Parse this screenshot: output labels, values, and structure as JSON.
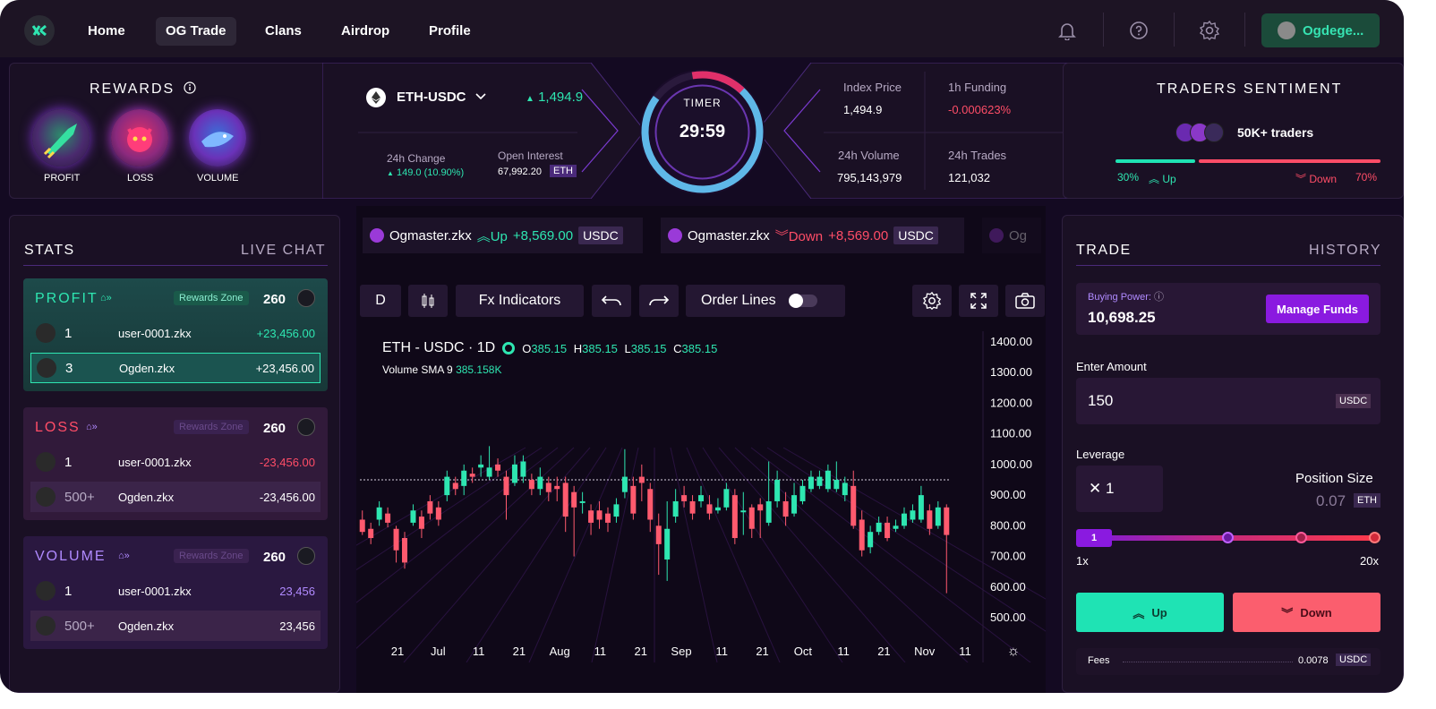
{
  "nav": {
    "items": [
      "Home",
      "OG Trade",
      "Clans",
      "Airdrop",
      "Profile"
    ],
    "user": "Ogdege..."
  },
  "rewards": {
    "title": "REWARDS",
    "badges": [
      "PROFIT",
      "LOSS",
      "VOLUME"
    ]
  },
  "market": {
    "pair": "ETH-USDC",
    "price": "1,494.9",
    "change_label": "24h Change",
    "change_value": "149.0 (10.90%)",
    "oi_label": "Open Interest",
    "oi_value": "67,992.20",
    "oi_unit": "ETH",
    "timer_label": "TIMER",
    "timer_value": "29:59",
    "index_label": "Index Price",
    "index_value": "1,494.9",
    "funding_label": "1h Funding",
    "funding_value": "-0.000623%",
    "volume_label": "24h Volume",
    "volume_value": "795,143,979",
    "trades_label": "24h Trades",
    "trades_value": "121,032"
  },
  "sentiment": {
    "title": "TRADERS SENTIMENT",
    "traders": "50K+ traders",
    "up_pct": "30%",
    "up_label": "Up",
    "down_label": "Down",
    "down_pct": "70%",
    "up_fraction": 0.3
  },
  "stats": {
    "tab_stats": "STATS",
    "tab_chat": "LIVE CHAT",
    "rewards_zone": "Rewards Zone",
    "profit": {
      "title": "PROFIT",
      "count": "260",
      "rows": [
        {
          "rank": "1",
          "name": "user-0001.zkx",
          "amount": "+23,456.00"
        },
        {
          "rank": "3",
          "name": "Ogden.zkx",
          "amount": "+23,456.00"
        }
      ]
    },
    "loss": {
      "title": "LOSS",
      "count": "260",
      "rows": [
        {
          "rank": "1",
          "name": "user-0001.zkx",
          "amount": "-23,456.00"
        },
        {
          "rank": "500+",
          "name": "Ogden.zkx",
          "amount": "-23,456.00"
        }
      ]
    },
    "volume": {
      "title": "VOLUME",
      "count": "260",
      "rows": [
        {
          "rank": "1",
          "name": "user-0001.zkx",
          "amount": "23,456"
        },
        {
          "rank": "500+",
          "name": "Ogden.zkx",
          "amount": "23,456"
        }
      ]
    }
  },
  "ticker": [
    {
      "user": "Ogmaster.zkx",
      "dir": "Up",
      "amount": "+8,569.00",
      "unit": "USDC"
    },
    {
      "user": "Ogmaster.zkx",
      "dir": "Down",
      "amount": "+8,569.00",
      "unit": "USDC"
    },
    {
      "user": "Og"
    }
  ],
  "toolbar": {
    "interval": "D",
    "indicators": "Fx Indicators",
    "order_lines": "Order Lines"
  },
  "legend": {
    "symbol": "ETH - USDC · 1D",
    "o_label": "O",
    "o_value": "385.15",
    "h_label": "H",
    "h_value": "385.15",
    "l_label": "L",
    "l_value": "385.15",
    "c_label": "C",
    "c_value": "385.15",
    "vol_label": "Volume SMA 9",
    "vol_value": "385.158K"
  },
  "chart_data": {
    "type": "candlestick",
    "y_ticks": [
      "1400.00",
      "1300.00",
      "1200.00",
      "1100.00",
      "1000.00",
      "900.00",
      "800.00",
      "700.00",
      "600.00",
      "500.00"
    ],
    "ylim": [
      500,
      1400
    ],
    "x_ticks": [
      "21",
      "Jul",
      "11",
      "21",
      "Aug",
      "11",
      "21",
      "Sep",
      "11",
      "21",
      "Oct",
      "11",
      "21",
      "Nov",
      "11"
    ],
    "reference_line": 950,
    "candles": [
      [
        820,
        780,
        850,
        770
      ],
      [
        790,
        760,
        810,
        740
      ],
      [
        820,
        860,
        880,
        800
      ],
      [
        840,
        810,
        860,
        795
      ],
      [
        790,
        720,
        800,
        680
      ],
      [
        760,
        680,
        780,
        660
      ],
      [
        810,
        850,
        870,
        800
      ],
      [
        830,
        790,
        850,
        760
      ],
      [
        880,
        840,
        900,
        820
      ],
      [
        860,
        820,
        880,
        800
      ],
      [
        900,
        960,
        980,
        880
      ],
      [
        940,
        920,
        960,
        900
      ],
      [
        930,
        980,
        1000,
        900
      ],
      [
        970,
        960,
        990,
        940
      ],
      [
        990,
        1000,
        1030,
        960
      ],
      [
        960,
        990,
        1060,
        950
      ],
      [
        1000,
        980,
        1020,
        960
      ],
      [
        960,
        900,
        980,
        820
      ],
      [
        940,
        1000,
        1030,
        930
      ],
      [
        960,
        1010,
        1030,
        940
      ],
      [
        950,
        920,
        970,
        900
      ],
      [
        920,
        960,
        990,
        900
      ],
      [
        940,
        910,
        960,
        880
      ],
      [
        930,
        920,
        960,
        880
      ],
      [
        940,
        830,
        960,
        780
      ],
      [
        910,
        860,
        930,
        700
      ],
      [
        880,
        880,
        910,
        840
      ],
      [
        850,
        810,
        870,
        770
      ],
      [
        850,
        820,
        880,
        790
      ],
      [
        840,
        810,
        860,
        780
      ],
      [
        830,
        870,
        890,
        810
      ],
      [
        910,
        960,
        1050,
        890
      ],
      [
        930,
        840,
        960,
        820
      ],
      [
        960,
        940,
        1000,
        880
      ],
      [
        920,
        820,
        940,
        780
      ],
      [
        800,
        740,
        840,
        640
      ],
      [
        690,
        790,
        880,
        620
      ],
      [
        830,
        880,
        920,
        810
      ],
      [
        900,
        880,
        930,
        860
      ],
      [
        880,
        840,
        900,
        820
      ],
      [
        880,
        900,
        930,
        860
      ],
      [
        870,
        840,
        900,
        820
      ],
      [
        850,
        860,
        890,
        840
      ],
      [
        860,
        920,
        940,
        850
      ],
      [
        900,
        760,
        920,
        740
      ],
      [
        850,
        850,
        910,
        770
      ],
      [
        860,
        790,
        870,
        760
      ],
      [
        870,
        850,
        890,
        760
      ],
      [
        810,
        880,
        1010,
        800
      ],
      [
        880,
        950,
        980,
        860
      ],
      [
        880,
        830,
        910,
        800
      ],
      [
        840,
        900,
        940,
        830
      ],
      [
        880,
        930,
        950,
        870
      ],
      [
        920,
        960,
        980,
        910
      ],
      [
        930,
        960,
        980,
        920
      ],
      [
        920,
        980,
        1000,
        910
      ],
      [
        920,
        950,
        1010,
        910
      ],
      [
        900,
        940,
        960,
        880
      ],
      [
        930,
        800,
        980,
        790
      ],
      [
        820,
        720,
        850,
        700
      ],
      [
        730,
        780,
        800,
        710
      ],
      [
        780,
        810,
        830,
        770
      ],
      [
        810,
        760,
        830,
        750
      ],
      [
        790,
        800,
        820,
        780
      ],
      [
        800,
        840,
        860,
        790
      ],
      [
        820,
        850,
        870,
        810
      ],
      [
        820,
        900,
        930,
        810
      ],
      [
        850,
        790,
        870,
        770
      ],
      [
        800,
        860,
        880,
        790
      ],
      [
        860,
        770,
        870,
        580
      ]
    ]
  },
  "trade": {
    "tab_trade": "TRADE",
    "tab_history": "HISTORY",
    "buying_power_label": "Buying Power:",
    "buying_power": "10,698.25",
    "manage_funds": "Manage Funds",
    "enter_amount": "Enter Amount",
    "amount": "150",
    "amount_unit": "USDC",
    "leverage_label": "Leverage",
    "leverage_value": "1",
    "position_size_label": "Position Size",
    "position_size": "0.07",
    "position_unit": "ETH",
    "slider_min": "1x",
    "slider_max": "20x",
    "slider_value": "1",
    "up": "Up",
    "down": "Down",
    "fees_label": "Fees",
    "fees_value": "0.0078",
    "fees_unit": "USDC"
  }
}
